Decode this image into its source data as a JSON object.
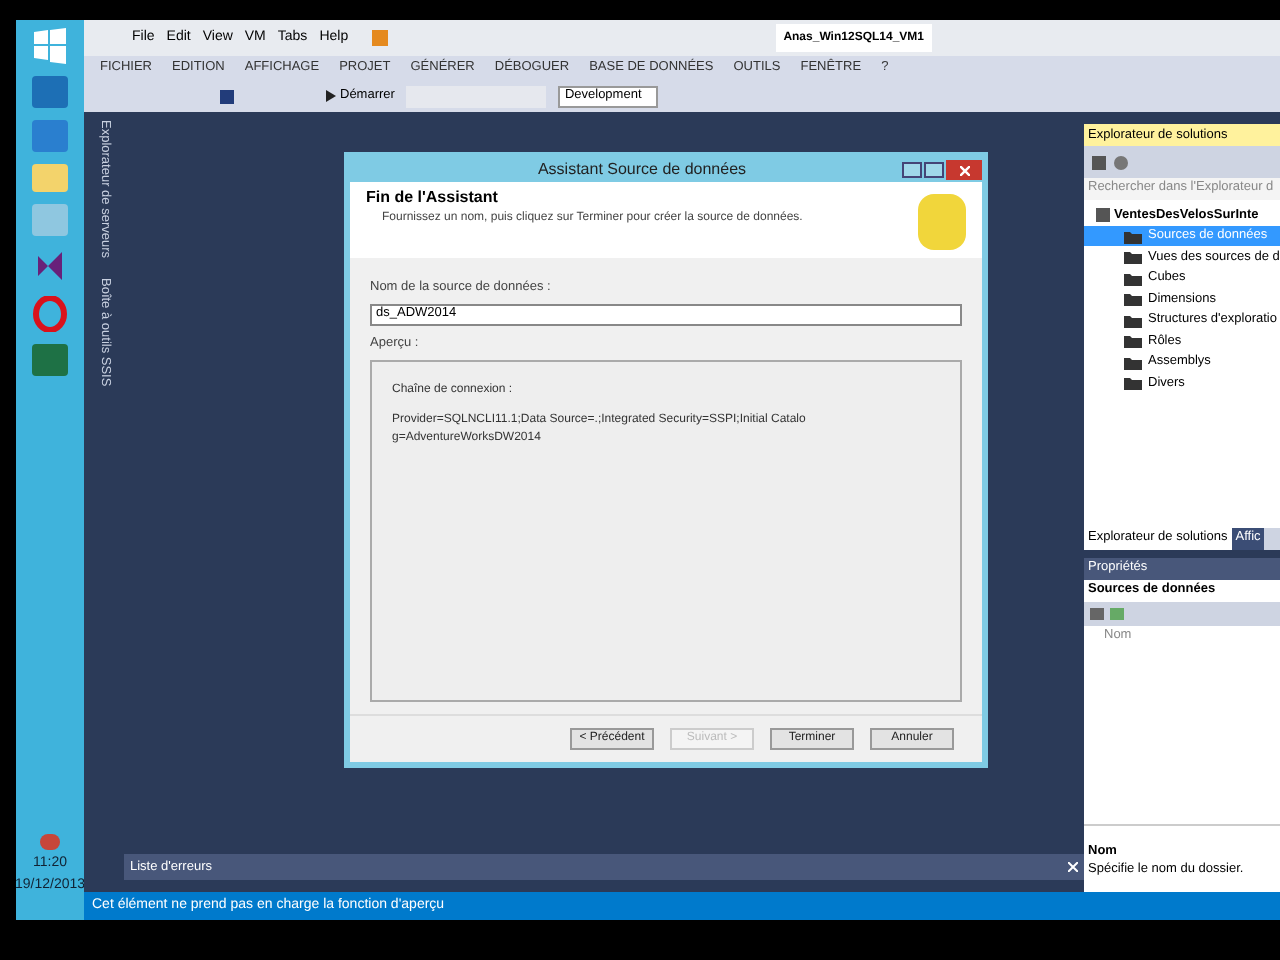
{
  "vm_toolbar": {
    "menu": [
      "File",
      "Edit",
      "View",
      "VM",
      "Tabs",
      "Help"
    ],
    "tab": "Anas_Win12SQL14_VM1"
  },
  "menu_bar": [
    "FICHIER",
    "EDITION",
    "AFFICHAGE",
    "PROJET",
    "GÉNÉRER",
    "DÉBOGUER",
    "BASE DE DONNÉES",
    "OUTILS",
    "FENÊTRE",
    "?"
  ],
  "toolbar": {
    "start": "Démarrer",
    "configuration": "Development"
  },
  "side_tabs": [
    "Explorateur de serveurs",
    "Boîte à outils SSIS"
  ],
  "dialog": {
    "title": "Assistant Source de données",
    "heading": "Fin de l'Assistant",
    "subtitle": "Fournissez un nom, puis cliquez sur Terminer pour créer la source de données.",
    "name_label": "Nom de la source de données :",
    "name_value": "ds_ADW2014",
    "preview_label": "Aperçu :",
    "connection_label": "Chaîne de connexion :",
    "connection_string": "Provider=SQLNCLI11.1;Data Source=.;Integrated Security=SSPI;Initial Catalog=AdventureWorksDW2014",
    "buttons": [
      {
        "label": "< Précédent",
        "disabled": false
      },
      {
        "label": "Suivant >",
        "disabled": true
      },
      {
        "label": "Terminer",
        "disabled": false
      },
      {
        "label": "Annuler",
        "disabled": false
      }
    ]
  },
  "solution_explorer": {
    "title": "Explorateur de solutions",
    "search": "Rechercher dans l'Explorateur d",
    "root": "VentesDesVelosSurInte",
    "items": [
      {
        "label": "Sources de données",
        "selected": true
      },
      {
        "label": "Vues des sources de d",
        "selected": false
      },
      {
        "label": "Cubes",
        "selected": false
      },
      {
        "label": "Dimensions",
        "selected": false
      },
      {
        "label": "Structures d'exploratio",
        "selected": false
      },
      {
        "label": "Rôles",
        "selected": false
      },
      {
        "label": "Assemblys",
        "selected": false
      },
      {
        "label": "Divers",
        "selected": false
      }
    ],
    "tabs": [
      {
        "label": "Explorateur de solutions",
        "selected": true
      },
      {
        "label": "Affic",
        "selected": false
      }
    ]
  },
  "properties": {
    "title": "Propriétés",
    "object": "Sources de données",
    "row": "Nom",
    "description_title": "Nom",
    "description": "Spécifie le nom du dossier."
  },
  "error_list": {
    "title": "Liste d'erreurs"
  },
  "taskbar": {
    "time": "11:20",
    "date": "19/12/2013"
  },
  "status_bar": "Cet élément ne prend pas en charge la fonction d'aperçu"
}
